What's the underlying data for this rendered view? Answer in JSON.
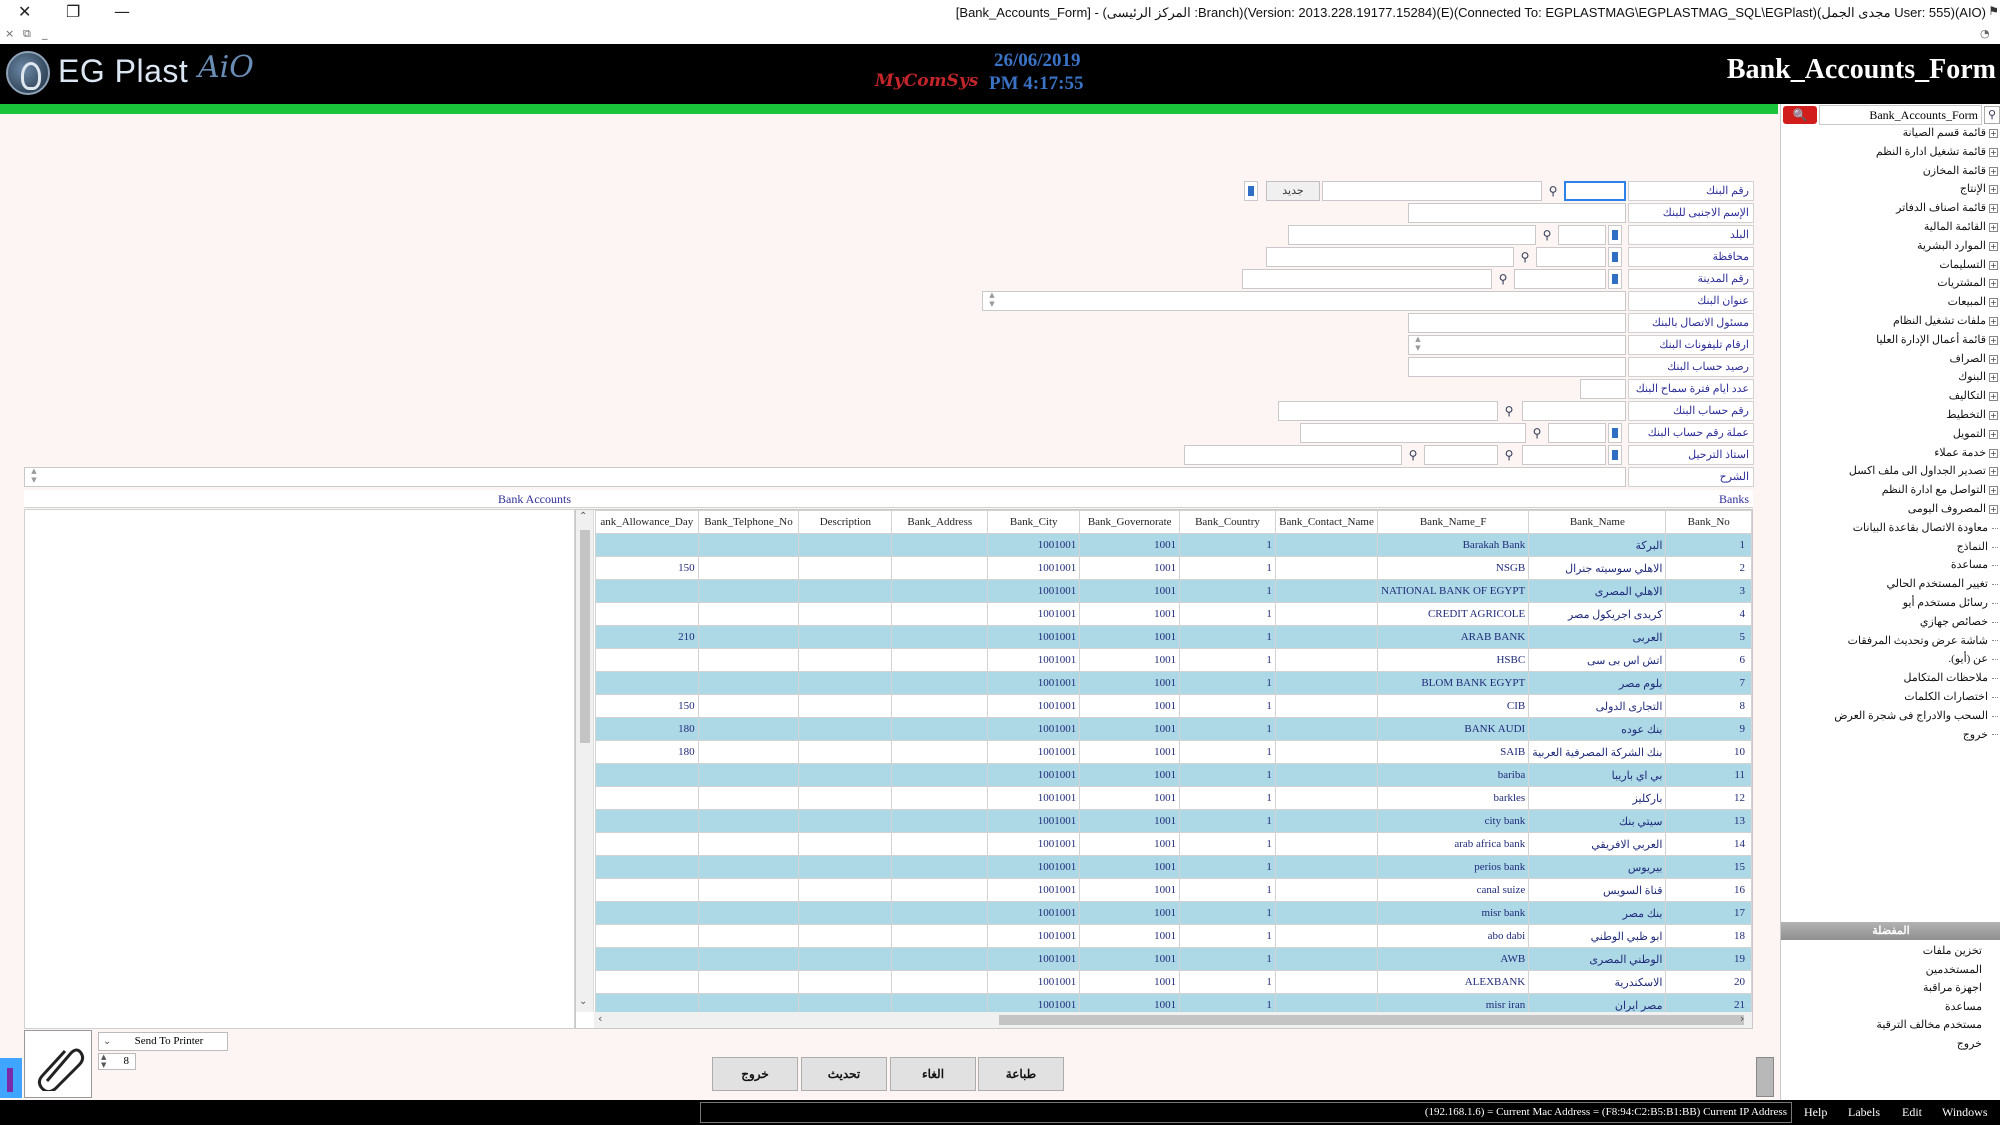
{
  "window": {
    "title": "[Bank_Accounts_Form] - (المركز الرئيسى :Branch)(Version: 2013.228.19177.15284)(E)(Connected To: EGPLASTMAG\\EGPLASTMAG_SQL\\EGPlast)(مجدى الجمل User: 555)(AIO)",
    "close_glyph": "✕",
    "restore_glyph": "❐",
    "min_glyph": "—",
    "sub_close": "×",
    "sub_restore": "⧉",
    "sub_min": "_",
    "end_icon": "◔"
  },
  "header": {
    "logo_text": "EG Plast",
    "logo_suffix": "AiO",
    "brand_mid": "MyComSys",
    "date": "26/06/2019",
    "time": "PM 4:17:55",
    "form_name": "Bank_Accounts_Form"
  },
  "sidebar": {
    "search_value": "Bank_Accounts_Form",
    "search_icon": "magnifier-icon",
    "tree_items": [
      "قائمة قسم الصيانة",
      "قائمة تشغيل ادارة النظم",
      "قائمة المخازن",
      "الإنتاج",
      "قائمة اصناف الدفاتر",
      "القائمة المالية",
      "الموارد البشرية",
      "التسليمات",
      "المشتريات",
      "المبيعات",
      "ملفات تشغيل النظام",
      "قائمة أعمال الإدارة العليا",
      "الصراف",
      "البنوك",
      "التكاليف",
      "التخطيط",
      "التمويل",
      "خدمة عملاء",
      "تصدير الجداول الى ملف اكسل",
      "التواصل مع ادارة النظم",
      "المصروف اليومى",
      "معاودة الاتصال بقاعدة البيانات",
      "النماذج",
      "مساعدة",
      "تغيير المستخدم الحالي",
      "رسائل مستخدم أيو",
      "خصائص جهازي",
      "شاشة عرض وتحديث المرفقات",
      "عن (أيو).",
      "ملاحظات المتكامل",
      "اختصارات الكلمات",
      "السحب والادراج فى شجرة العرض",
      "خروج"
    ],
    "favorites_title": "المفضلة",
    "favorites": [
      "تخزين ملفات",
      "المستخدمين",
      "اجهزة مراقبة",
      "مساعدة",
      "مستخدم مخالف الترقية",
      "خروج"
    ]
  },
  "form": {
    "labels": {
      "bank_no": "رقم البنك",
      "foreign_name": "الإسم الاجنبى للبنك",
      "country": "البلد",
      "governorate": "محافظة",
      "city_no": "رقم المدينة",
      "address": "عنوان البنك",
      "contact": "مسئول الاتصال بالبنك",
      "phones": "ارقام تليفونات البنك",
      "balance": "رصيد حساب البنك",
      "allowance_days": "عدد ايام فترة سماح البنك",
      "account_no": "رقم حساب البنك",
      "currency": "عملة رقم حساب البنك",
      "posting": "استاذ الترحيل",
      "description": "الشرح"
    },
    "new_button": "جديد",
    "bank_no_value": ""
  },
  "sections": {
    "bank_accounts": "Bank Accounts",
    "banks": "Banks"
  },
  "grid": {
    "columns": [
      "ank_Allowance_Day",
      "Bank_Telphone_No",
      "Description",
      "Bank_Address",
      "Bank_City",
      "Bank_Governorate",
      "Bank_Country",
      "Bank_Contact_Name",
      "Bank_Name_F",
      "Bank_Name",
      "Bank_No"
    ],
    "rows": [
      {
        "allowance": "",
        "city": "1001001",
        "gov": "1001",
        "country": "1",
        "name_f": "Barakah Bank",
        "name": "البركة",
        "no": "1"
      },
      {
        "allowance": "150",
        "city": "1001001",
        "gov": "1001",
        "country": "1",
        "name_f": "NSGB",
        "name": "الاهلي سوسيته جنرال",
        "no": "2"
      },
      {
        "allowance": "",
        "city": "1001001",
        "gov": "1001",
        "country": "1",
        "name_f": "NATIONAL BANK OF EGYPT",
        "name": "الاهلي المصرى",
        "no": "3"
      },
      {
        "allowance": "",
        "city": "1001001",
        "gov": "1001",
        "country": "1",
        "name_f": "CREDIT AGRICOLE",
        "name": "كريدى اجريكول مصر",
        "no": "4"
      },
      {
        "allowance": "210",
        "city": "1001001",
        "gov": "1001",
        "country": "1",
        "name_f": "ARAB BANK",
        "name": "العربى",
        "no": "5"
      },
      {
        "allowance": "",
        "city": "1001001",
        "gov": "1001",
        "country": "1",
        "name_f": "HSBC",
        "name": "اتش اس بى سى",
        "no": "6"
      },
      {
        "allowance": "",
        "city": "1001001",
        "gov": "1001",
        "country": "1",
        "name_f": "BLOM BANK EGYPT",
        "name": "بلوم مصر",
        "no": "7"
      },
      {
        "allowance": "150",
        "city": "1001001",
        "gov": "1001",
        "country": "1",
        "name_f": "CIB",
        "name": "التجارى الدولى",
        "no": "8"
      },
      {
        "allowance": "180",
        "city": "1001001",
        "gov": "1001",
        "country": "1",
        "name_f": "BANK AUDI",
        "name": "بنك عوده",
        "no": "9"
      },
      {
        "allowance": "180",
        "city": "1001001",
        "gov": "1001",
        "country": "1",
        "name_f": "SAIB",
        "name": "بنك الشركة المصرفية العربية",
        "no": "10"
      },
      {
        "allowance": "",
        "city": "1001001",
        "gov": "1001",
        "country": "1",
        "name_f": "bariba",
        "name": "بي اي باريبا",
        "no": "11"
      },
      {
        "allowance": "",
        "city": "1001001",
        "gov": "1001",
        "country": "1",
        "name_f": "barkles",
        "name": "باركليز",
        "no": "12"
      },
      {
        "allowance": "",
        "city": "1001001",
        "gov": "1001",
        "country": "1",
        "name_f": "city bank",
        "name": "سيتي بنك",
        "no": "13"
      },
      {
        "allowance": "",
        "city": "1001001",
        "gov": "1001",
        "country": "1",
        "name_f": "arab africa bank",
        "name": "العربي الافريقي",
        "no": "14"
      },
      {
        "allowance": "",
        "city": "1001001",
        "gov": "1001",
        "country": "1",
        "name_f": "perios bank",
        "name": "بيريوس",
        "no": "15"
      },
      {
        "allowance": "",
        "city": "1001001",
        "gov": "1001",
        "country": "1",
        "name_f": "canal suize",
        "name": "قناة السويس",
        "no": "16"
      },
      {
        "allowance": "",
        "city": "1001001",
        "gov": "1001",
        "country": "1",
        "name_f": "misr bank",
        "name": "بنك مصر",
        "no": "17"
      },
      {
        "allowance": "",
        "city": "1001001",
        "gov": "1001",
        "country": "1",
        "name_f": "abo dabi",
        "name": "ابو ظبي الوطني",
        "no": "18"
      },
      {
        "allowance": "",
        "city": "1001001",
        "gov": "1001",
        "country": "1",
        "name_f": "AWB",
        "name": "الوطني المصرى",
        "no": "19"
      },
      {
        "allowance": "",
        "city": "1001001",
        "gov": "1001",
        "country": "1",
        "name_f": "ALEXBANK",
        "name": "الاسكندرية",
        "no": "20"
      },
      {
        "allowance": "",
        "city": "1001001",
        "gov": "1001",
        "country": "1",
        "name_f": "misr iran",
        "name": "مصر ايران",
        "no": "21"
      }
    ]
  },
  "bottom": {
    "printer": "Send To Printer",
    "copies": "8",
    "buttons": {
      "exit": "خروج",
      "refresh": "تحديث",
      "cancel": "الغاء",
      "print": "طباعة"
    }
  },
  "status": {
    "text": "(192.168.1.6) = Current Mac Address = (F8:94:C2:B5:B1:BB) Current IP Address",
    "menus": [
      "Help",
      "Labels",
      "Edit",
      "Windows"
    ]
  },
  "colors": {
    "accent_green": "#19c43a",
    "row_alt": "#add8e6",
    "header_bg": "#000000",
    "date_blue": "#3a73c5"
  }
}
